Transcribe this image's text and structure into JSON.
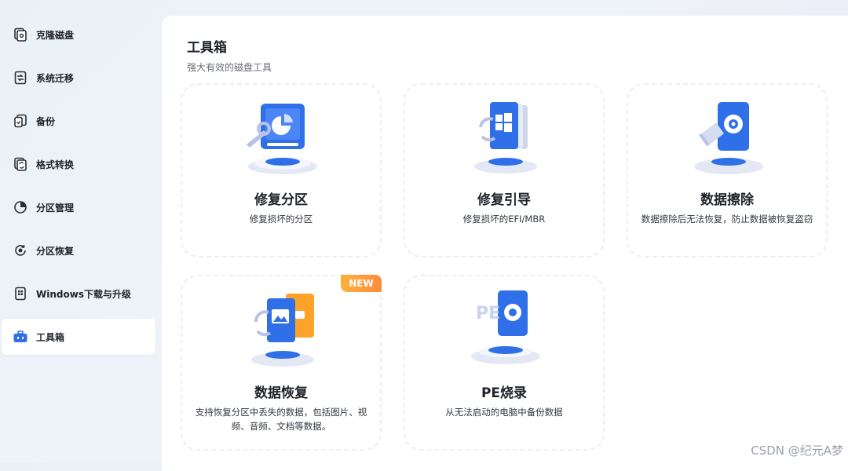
{
  "sidebar": {
    "items": [
      {
        "label": "克隆磁盘",
        "icon": "clone-disk-icon"
      },
      {
        "label": "系统迁移",
        "icon": "system-migration-icon"
      },
      {
        "label": "备份",
        "icon": "backup-icon"
      },
      {
        "label": "格式转换",
        "icon": "format-convert-icon"
      },
      {
        "label": "分区管理",
        "icon": "partition-manage-icon"
      },
      {
        "label": "分区恢复",
        "icon": "partition-recovery-icon"
      },
      {
        "label": "Windows下载与升级",
        "icon": "windows-download-icon"
      },
      {
        "label": "工具箱",
        "icon": "toolbox-icon",
        "active": true
      }
    ]
  },
  "main": {
    "title": "工具箱",
    "subtitle": "强大有效的磁盘工具",
    "cards": [
      {
        "title": "修复分区",
        "desc": "修复损坏的分区",
        "icon": "repair-partition-icon"
      },
      {
        "title": "修复引导",
        "desc": "修复损坏的EFI/MBR",
        "icon": "repair-boot-icon"
      },
      {
        "title": "数据擦除",
        "desc": "数据擦除后无法恢复，防止数据被恢复盗窃",
        "icon": "data-wipe-icon"
      },
      {
        "title": "数据恢复",
        "desc": "支持恢复分区中丢失的数据，包括图片、视频、音频、文档等数据。",
        "icon": "data-recovery-icon",
        "badge": "NEW"
      },
      {
        "title": "PE烧录",
        "desc": "从无法启动的电脑中备份数据",
        "icon": "pe-burn-icon"
      }
    ]
  },
  "watermark": "CSDN @纪元A梦",
  "colors": {
    "accent": "#2f6fe8",
    "badge": "#ff9a3a",
    "active_bg": "#ffffff"
  }
}
